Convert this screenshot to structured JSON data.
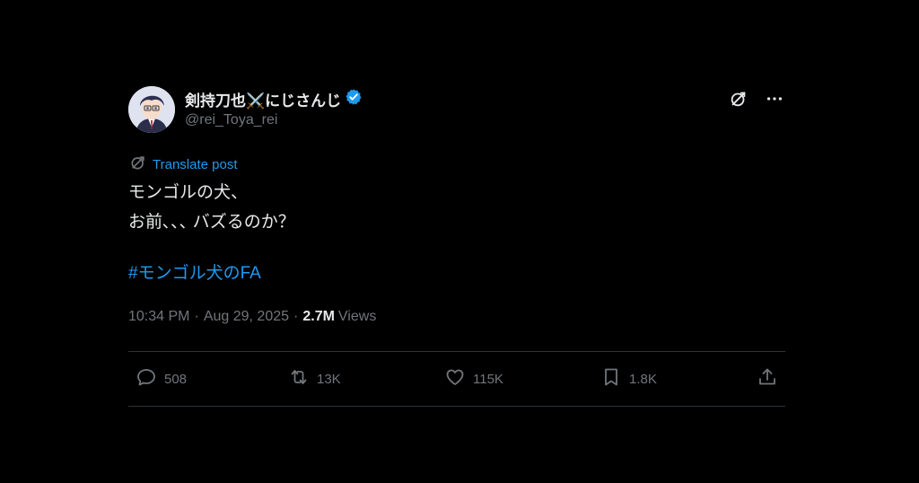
{
  "author": {
    "display_name": "剣持刀也⚔️にじさんじ",
    "handle": "@rei_Toya_rei",
    "verified": true
  },
  "translate": {
    "label": "Translate post"
  },
  "post": {
    "lines": [
      "モンゴルの犬、",
      "お前､､､ バズるのか？"
    ],
    "hashtag": "#モンゴル犬のFA"
  },
  "meta": {
    "time": "10:34 PM",
    "separator": "·",
    "date": "Aug 29, 2025",
    "views_count": "2.7M",
    "views_label": "Views"
  },
  "actions": {
    "replies": "508",
    "reposts": "13K",
    "likes": "115K",
    "bookmarks": "1.8K"
  },
  "colors": {
    "background": "#000000",
    "text": "#e7e9ea",
    "muted": "#71767b",
    "accent": "#1d9bf0",
    "divider": "#2f3336"
  },
  "icons": [
    "avatar",
    "verified-badge-icon",
    "grok-icon",
    "more-icon",
    "translate-icon",
    "reply-icon",
    "retweet-icon",
    "like-icon",
    "bookmark-icon",
    "share-icon"
  ]
}
